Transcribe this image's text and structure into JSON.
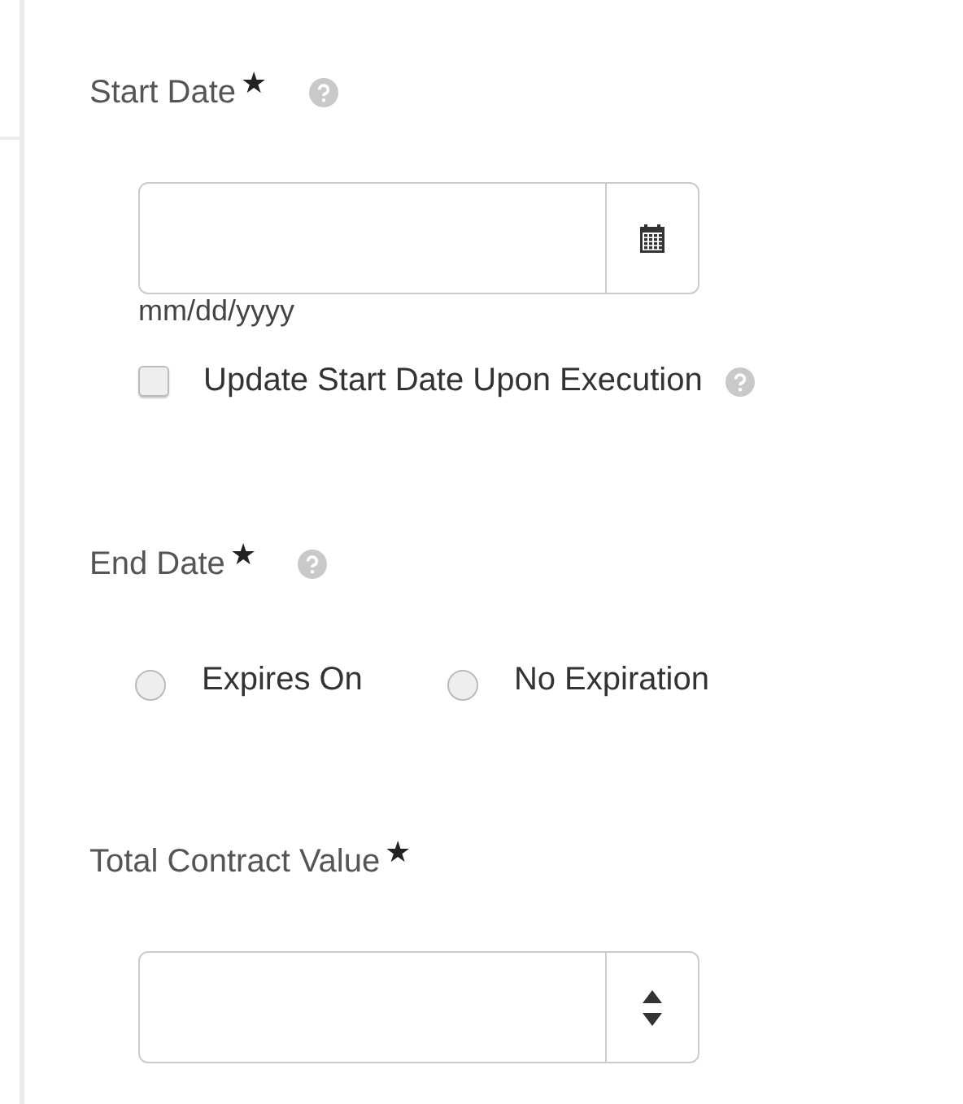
{
  "fields": [
    {
      "kind": "date",
      "label": "Start Date",
      "required_mark": "★",
      "help": true,
      "hint": "mm/dd/yyyy",
      "checkbox": {
        "label": "Update Start Date Upon Execution",
        "checked": false,
        "help": true
      }
    },
    {
      "kind": "radios",
      "label": "End Date",
      "required_mark": "★",
      "help": true,
      "options": [
        {
          "label": "Expires On",
          "selected": false
        },
        {
          "label": "No Expiration",
          "selected": false
        }
      ]
    },
    {
      "kind": "number",
      "label": "Total Contract Value",
      "required_mark": "★",
      "help": false
    }
  ]
}
